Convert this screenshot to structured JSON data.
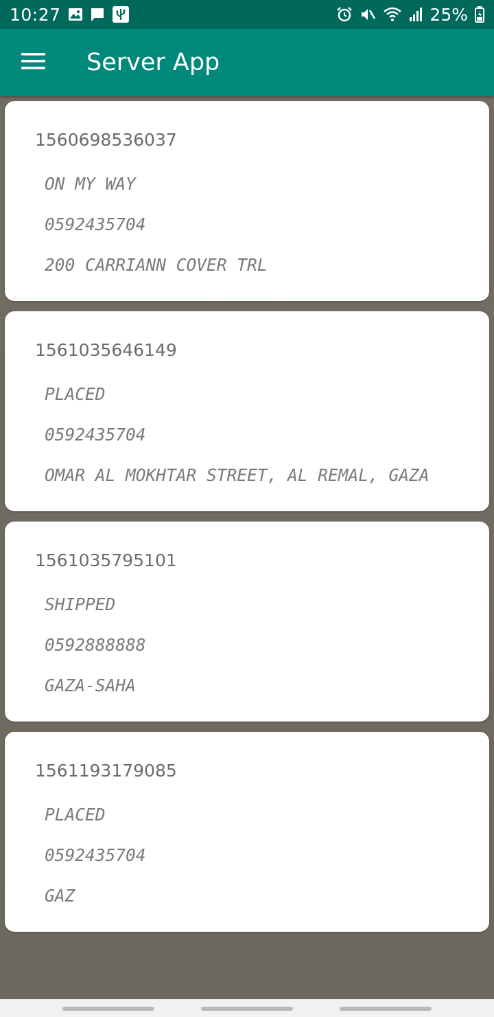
{
  "status_bar": {
    "time": "10:27",
    "battery": "25%",
    "left_icons": [
      "gallery-icon",
      "message-icon",
      "usb-icon"
    ],
    "right_icons": [
      "alarm-icon",
      "mute-icon",
      "wifi-icon",
      "signal-icon",
      "battery-icon"
    ]
  },
  "app_bar": {
    "title": "Server App",
    "menu_icon": "hamburger-menu-icon",
    "background": "#00897b",
    "status_bar_background": "#00695c"
  },
  "orders": [
    {
      "id": "1560698536037",
      "status": "ON MY WAY",
      "phone": "0592435704",
      "address": "200 CARRIANN COVER TRL"
    },
    {
      "id": "1561035646149",
      "status": "PLACED",
      "phone": "0592435704",
      "address": "OMAR AL MOKHTAR STREET, AL REMAL, GAZA"
    },
    {
      "id": "1561035795101",
      "status": "SHIPPED",
      "phone": "0592888888",
      "address": "GAZA-SAHA"
    },
    {
      "id": "1561193179085",
      "status": "PLACED",
      "phone": "0592435704",
      "address": "GAZ"
    }
  ]
}
